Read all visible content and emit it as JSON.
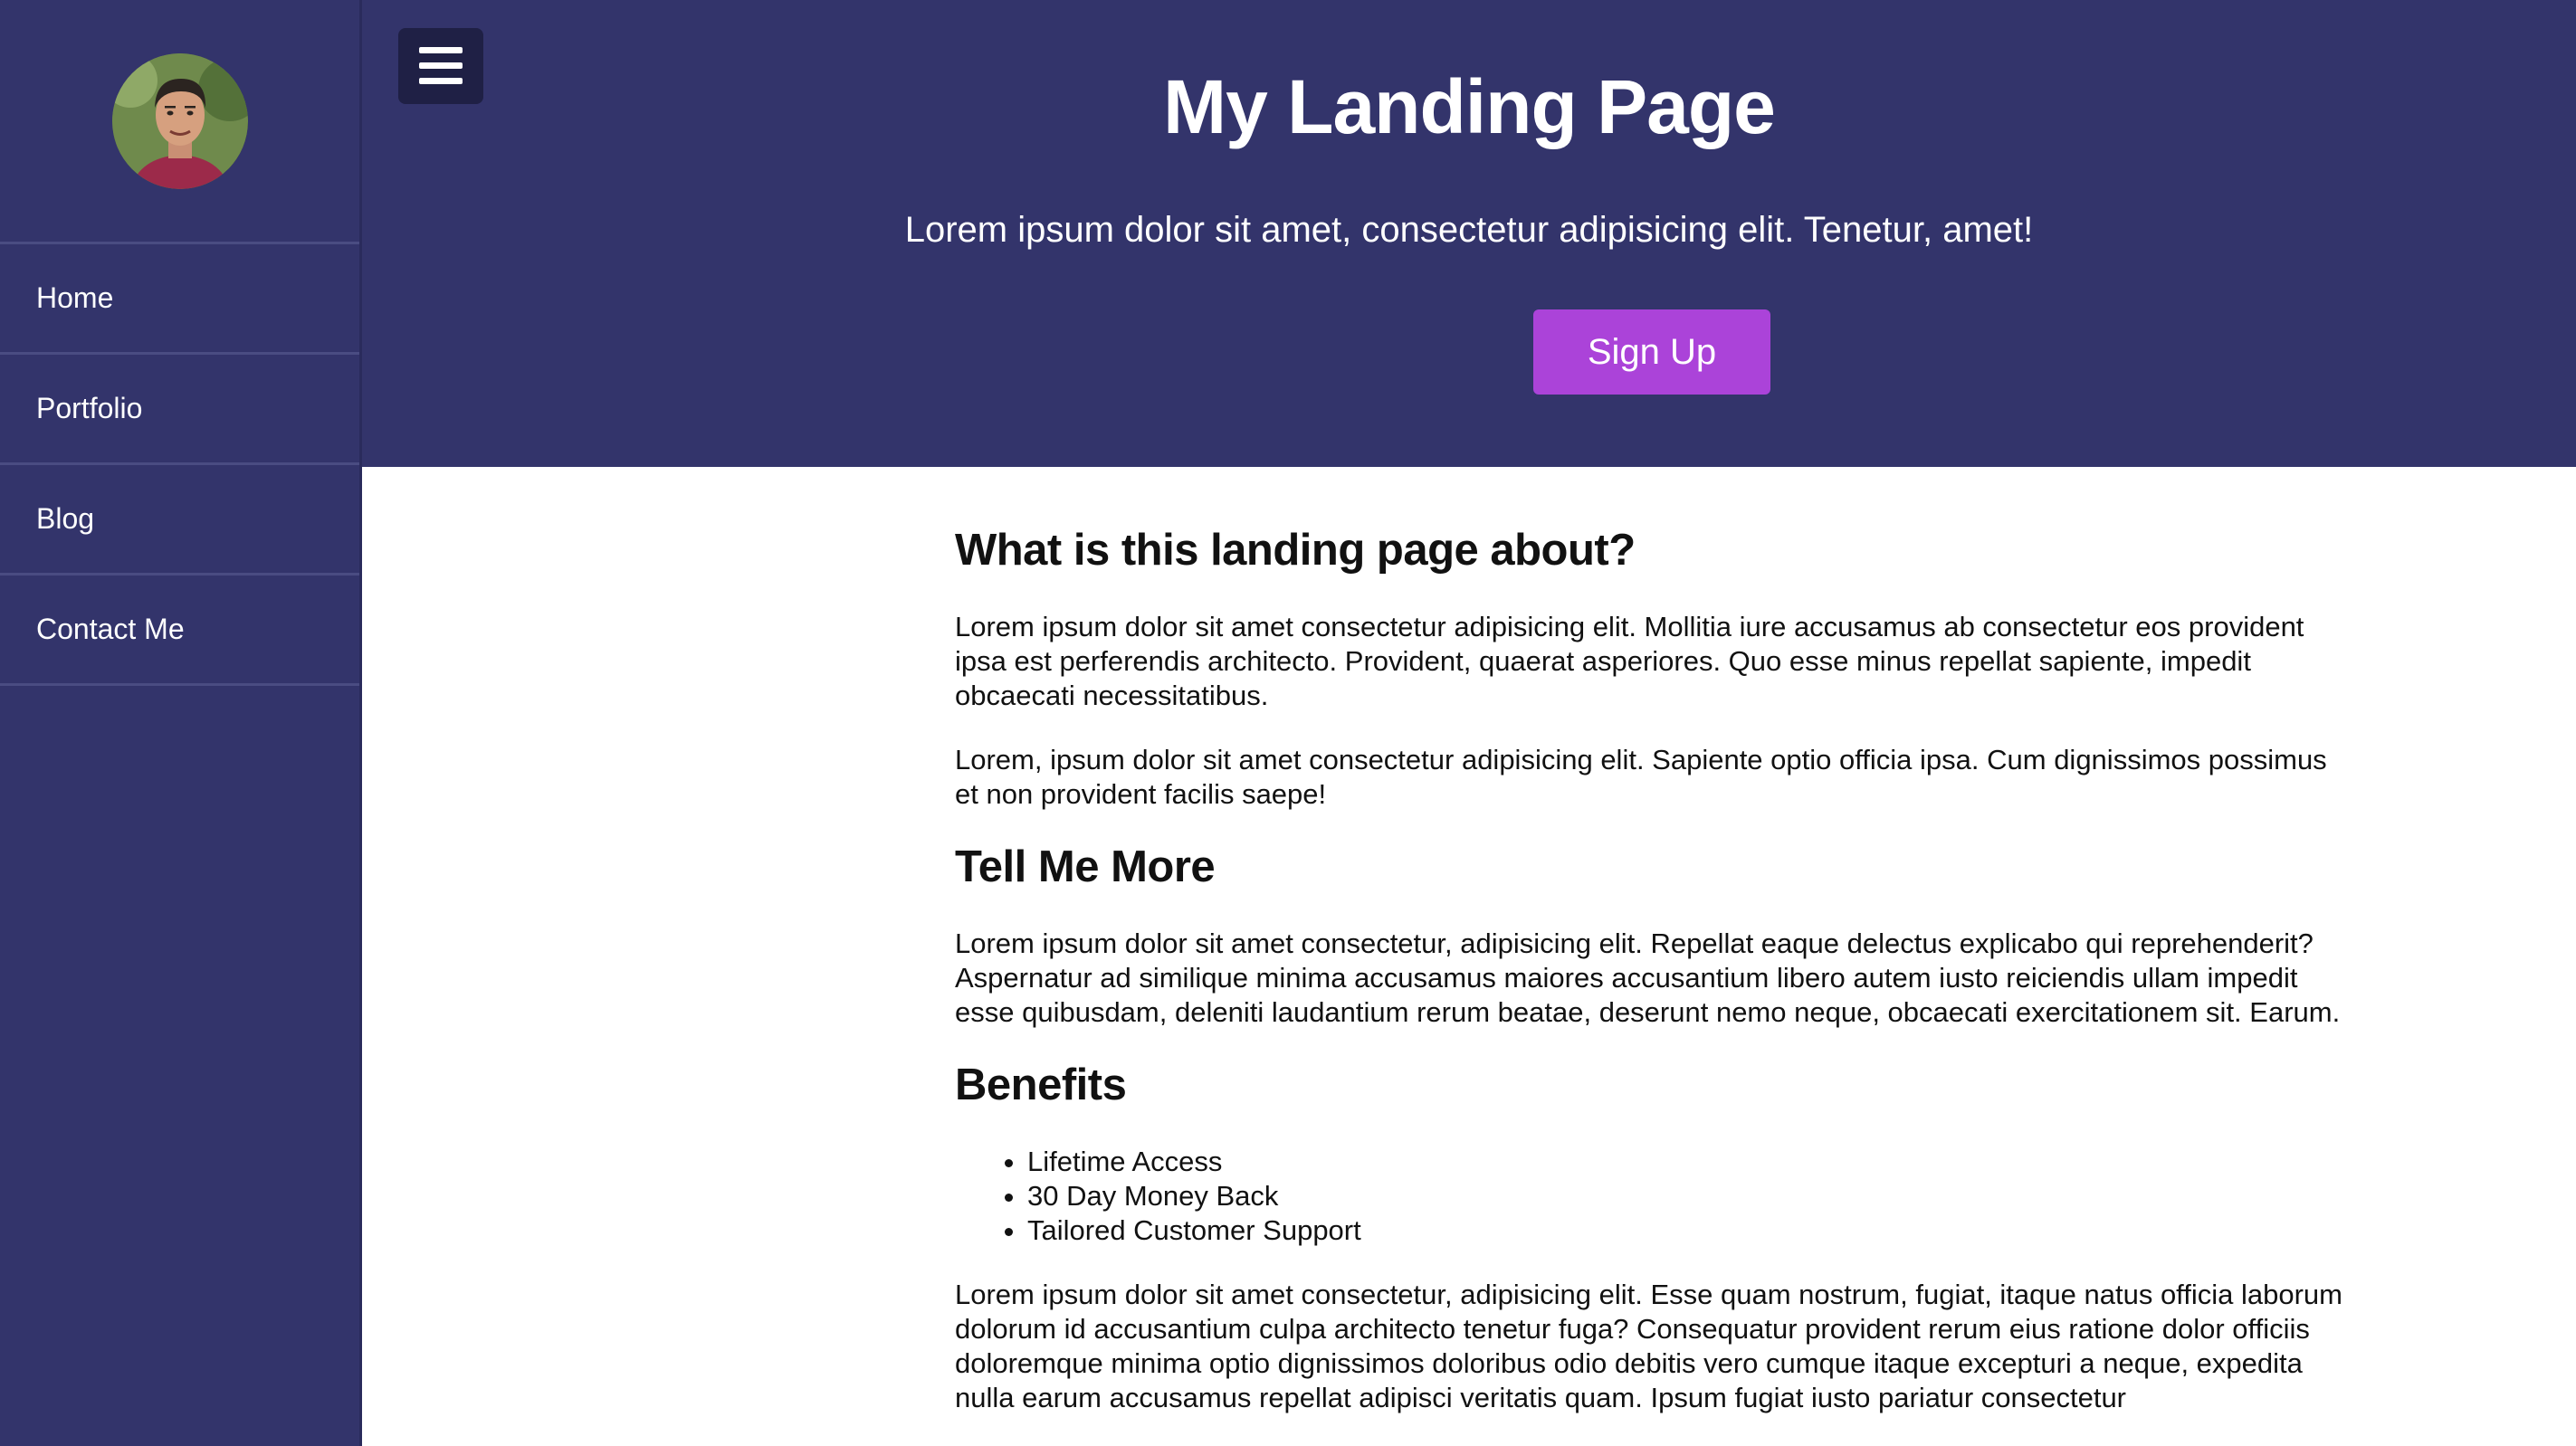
{
  "sidebar": {
    "avatar_alt": "profile photo",
    "items": [
      {
        "label": "Home"
      },
      {
        "label": "Portfolio"
      },
      {
        "label": "Blog"
      },
      {
        "label": "Contact Me"
      }
    ]
  },
  "header": {
    "menu_icon": "hamburger-menu-icon",
    "title": "My Landing Page",
    "subtitle": "Lorem ipsum dolor sit amet, consectetur adipisicing elit. Tenetur, amet!",
    "cta_label": "Sign Up"
  },
  "content": {
    "section1": {
      "heading": "What is this landing page about?",
      "p1": "Lorem ipsum dolor sit amet consectetur adipisicing elit. Mollitia iure accusamus ab consectetur eos provident ipsa est perferendis architecto. Provident, quaerat asperiores. Quo esse minus repellat sapiente, impedit obcaecati necessitatibus.",
      "p2": "Lorem, ipsum dolor sit amet consectetur adipisicing elit. Sapiente optio officia ipsa. Cum dignissimos possimus et non provident facilis saepe!"
    },
    "section2": {
      "heading": "Tell Me More",
      "p1": "Lorem ipsum dolor sit amet consectetur, adipisicing elit. Repellat eaque delectus explicabo qui reprehenderit? Aspernatur ad similique minima accusamus maiores accusantium libero autem iusto reiciendis ullam impedit esse quibusdam, deleniti laudantium rerum beatae, deserunt nemo neque, obcaecati exercitationem sit. Earum."
    },
    "section3": {
      "heading": "Benefits",
      "benefits": [
        "Lifetime Access",
        "30 Day Money Back",
        "Tailored Customer Support"
      ],
      "p1": "Lorem ipsum dolor sit amet consectetur, adipisicing elit. Esse quam nostrum, fugiat, itaque natus officia laborum dolorum id accusantium culpa architecto tenetur fuga? Consequatur provident rerum eius ratione dolor officiis doloremque minima optio dignissimos doloribus odio debitis vero cumque itaque excepturi a neque, expedita nulla earum accusamus repellat adipisci veritatis quam. Ipsum fugiat iusto pariatur consectetur"
    }
  },
  "colors": {
    "nav_bg": "#33346b",
    "menu_button_bg": "#1f2045",
    "cta_bg": "#ab43d9",
    "content_bg": "#ffffff"
  }
}
